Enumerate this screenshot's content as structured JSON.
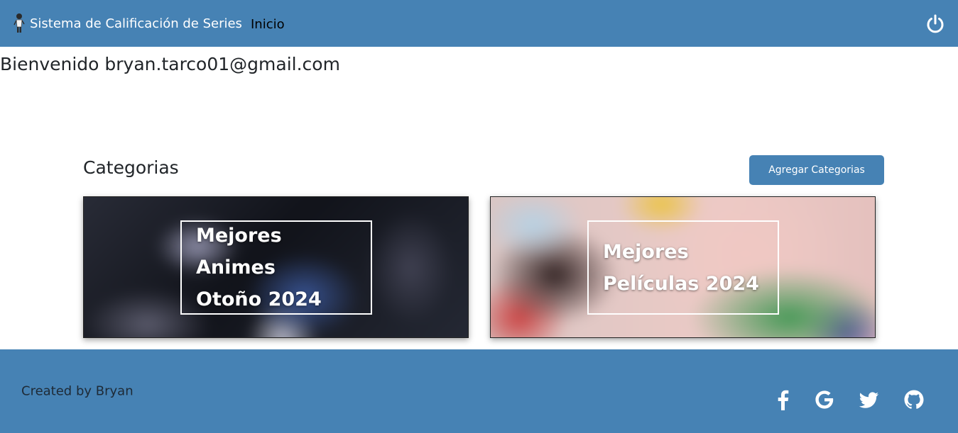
{
  "navbar": {
    "brand_text": "Sistema de Calificación de Series",
    "nav_link": "Inicio",
    "brand_color": "#4682b4",
    "logout_icon": "power-icon"
  },
  "welcome": {
    "text": "Bienvenido bryan.tarco01@gmail.com"
  },
  "categories": {
    "title": "Categorias",
    "add_button": "Agregar Categorias",
    "cards": [
      {
        "title": "Mejores Animes\nOtoño 2024"
      },
      {
        "title": "Mejores\nPelículas 2024"
      }
    ]
  },
  "footer": {
    "credit": "Created by Bryan",
    "social_icons": [
      "facebook-icon",
      "google-icon",
      "twitter-icon",
      "github-icon"
    ]
  }
}
